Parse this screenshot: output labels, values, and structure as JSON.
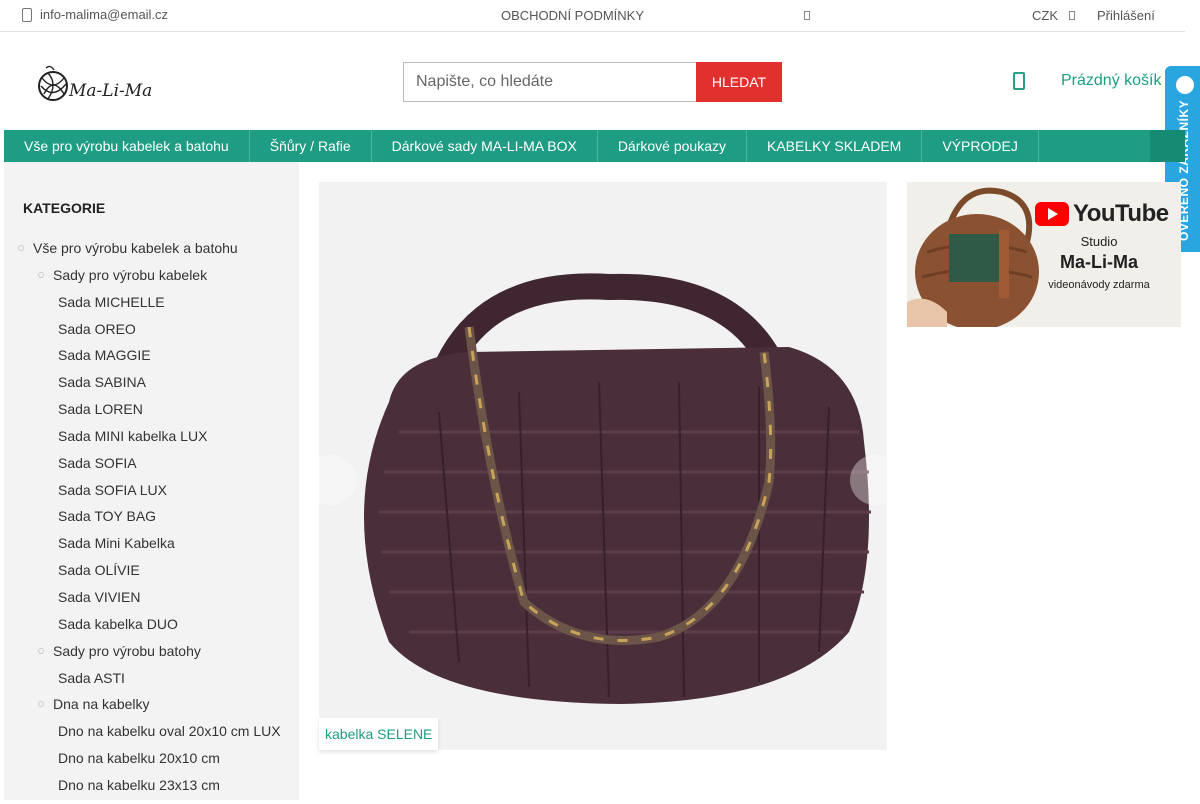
{
  "topbar": {
    "email": "info-malima@email.cz",
    "terms": "OBCHODNÍ PODMÍNKY",
    "currency": "CZK",
    "login": "Přihlášení"
  },
  "header": {
    "logo_text": "Ma-Li-Ma",
    "search_placeholder": "Napište, co hledáte",
    "search_button": "HLEDAT",
    "cart_label": "Prázdný košík"
  },
  "nav": {
    "items": [
      "Vše pro výrobu kabelek a batohu",
      "Šňůry / Rafie",
      "Dárkové sady MA-LI-MA BOX",
      "Dárkové poukazy",
      "KABELKY SKLADEM",
      "VÝPRODEJ"
    ]
  },
  "verified_badge": "OVĚŘENO ZÁKAZNÍKY",
  "sidebar": {
    "title": "KATEGORIE",
    "items": [
      {
        "label": "Vše pro výrobu kabelek a batohu",
        "level": 0
      },
      {
        "label": "Sady pro výrobu kabelek",
        "level": 1
      },
      {
        "label": "Sada MICHELLE",
        "level": 2
      },
      {
        "label": "Sada OREO",
        "level": 2
      },
      {
        "label": "Sada MAGGIE",
        "level": 2
      },
      {
        "label": "Sada SABINA",
        "level": 2
      },
      {
        "label": "Sada LOREN",
        "level": 2
      },
      {
        "label": "Sada MINI kabelka LUX",
        "level": 2
      },
      {
        "label": "Sada SOFIA",
        "level": 2
      },
      {
        "label": "Sada SOFIA LUX",
        "level": 2
      },
      {
        "label": "Sada TOY BAG",
        "level": 2
      },
      {
        "label": "Sada Mini Kabelka",
        "level": 2
      },
      {
        "label": "Sada OLÍVIE",
        "level": 2
      },
      {
        "label": "Sada VIVIEN",
        "level": 2
      },
      {
        "label": "Sada kabelka DUO",
        "level": 2
      },
      {
        "label": "Sady pro výrobu batohy",
        "level": 1
      },
      {
        "label": "Sada ASTI",
        "level": 2
      },
      {
        "label": "Dna na kabelky",
        "level": 1
      },
      {
        "label": "Dno na kabelku oval 20x10 cm LUX",
        "level": 2
      },
      {
        "label": "Dno na kabelku 20x10 cm",
        "level": 2
      },
      {
        "label": "Dno na kabelku 23x13 cm",
        "level": 2
      }
    ]
  },
  "slider": {
    "caption": "kabelka SELENE"
  },
  "youtube_banner": {
    "brand": "YouTube",
    "line1": "Studio",
    "line2": "Ma-Li-Ma",
    "line3": "videonávody zdarma"
  },
  "colors": {
    "brand_green": "#1f9c84",
    "search_red": "#e1302e",
    "verified_blue": "#29a5e0"
  }
}
